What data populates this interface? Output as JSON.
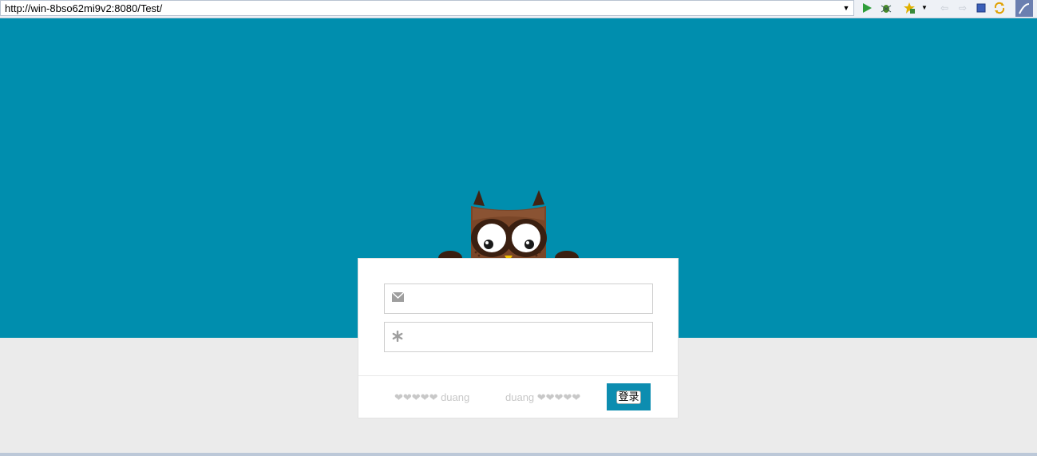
{
  "browser": {
    "url": "http://win-8bso62mi9v2:8080/Test/",
    "dropdown_glyph": "▼"
  },
  "colors": {
    "hero": "#008eae",
    "page_bg": "#ebebeb",
    "button": "#0d8db0"
  },
  "icons": {
    "email": "envelope-icon",
    "password": "asterisk-icon"
  },
  "login": {
    "email_value": "",
    "password_value": "",
    "remember_left": "❤❤❤❤❤ duang",
    "remember_right": "duang ❤❤❤❤❤",
    "button_label": "登录"
  }
}
